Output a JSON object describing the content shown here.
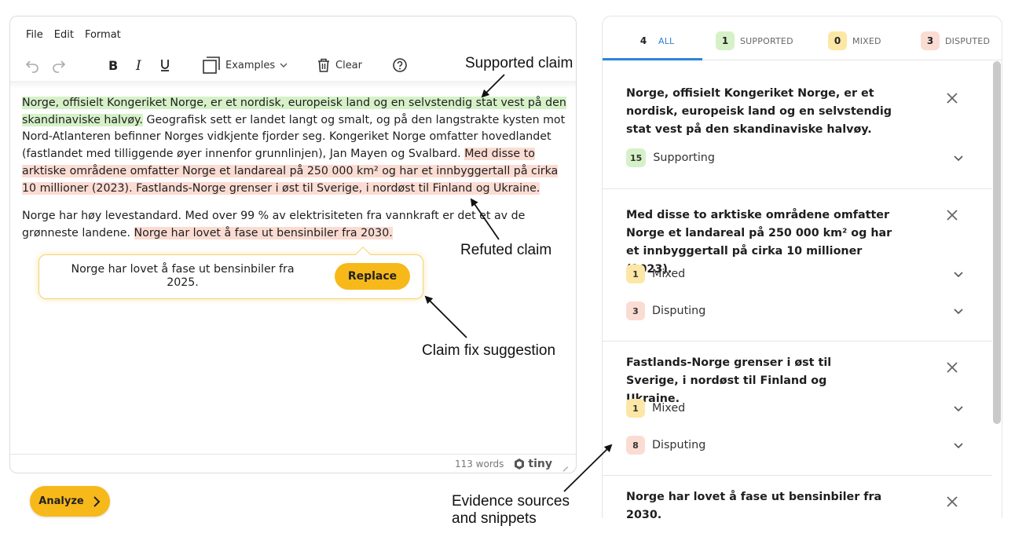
{
  "editor": {
    "menu": [
      "File",
      "Edit",
      "Format"
    ],
    "toolbar": {
      "examples_label": "Examples",
      "clear_label": "Clear"
    },
    "paragraph1": {
      "supported": "Norge, offisielt Kongeriket Norge, er et nordisk, europeisk land og en selvstendig stat vest på den skandinaviske halvøy.",
      "neutral": " Geografisk sett er landet langt og smalt, og på den langstrakte kysten mot Nord-Atlanteren befinner Norges vidkjente fjorder seg. Kongeriket Norge omfatter hovedlandet (fastlandet med tilliggende øyer innenfor grunnlinjen), Jan Mayen og Svalbard. ",
      "refuted1": "Med disse to arktiske områdene omfatter Norge et landareal på 250 000 km² og har et innbyggertall på cirka 10 millioner (2023).",
      "space": " ",
      "refuted2": "Fastlands-Norge grenser i øst til Sverige, i nordøst til Finland og Ukraine."
    },
    "paragraph2": {
      "neutral": "Norge har høy levestandard. Med over 99 % av elektrisiteten fra vannkraft er det et av de grønneste landene. ",
      "refuted": "Norge har lovet å fase ut bensinbiler fra 2030."
    },
    "word_count": "113 words",
    "brand": "tiny"
  },
  "suggestion": {
    "text": "Norge har lovet å fase ut bensinbiler fra 2025.",
    "button": "Replace"
  },
  "analyze_button": "Analyze",
  "annotations": {
    "supported": "Supported claim",
    "refuted": "Refuted claim",
    "fix": "Claim fix suggestion",
    "evidence_line1": "Evidence sources",
    "evidence_line2": "and snippets"
  },
  "tabs": [
    {
      "count": "4",
      "label": "ALL",
      "color": "#ffffff"
    },
    {
      "count": "1",
      "label": "SUPPORTED",
      "color": "#d6f1c8"
    },
    {
      "count": "0",
      "label": "MIXED",
      "color": "#fde7a6"
    },
    {
      "count": "3",
      "label": "DISPUTED",
      "color": "#fbdcd3"
    }
  ],
  "claims": [
    {
      "text": "Norge, offisielt Kongeriket Norge, er et nordisk, europeisk land og en selvstendig stat vest på den skandinaviske halvøy.",
      "evidence": [
        {
          "count": "15",
          "label": "Supporting",
          "color": "#d6f1c8"
        }
      ]
    },
    {
      "text": "Med disse to arktiske områdene omfatter Norge et landareal på 250 000 km² og har et innbyggertall på cirka 10 millioner (2023).",
      "evidence": [
        {
          "count": "1",
          "label": "Mixed",
          "color": "#fde7a6"
        },
        {
          "count": "3",
          "label": "Disputing",
          "color": "#fbdcd3"
        }
      ]
    },
    {
      "text": "Fastlands-Norge grenser i øst til Sverige, i nordøst til Finland og Ukraine.",
      "evidence": [
        {
          "count": "1",
          "label": "Mixed",
          "color": "#fde7a6"
        },
        {
          "count": "8",
          "label": "Disputing",
          "color": "#fbdcd3"
        }
      ]
    },
    {
      "text": "Norge har lovet å fase ut bensinbiler fra 2030.",
      "evidence": []
    }
  ]
}
